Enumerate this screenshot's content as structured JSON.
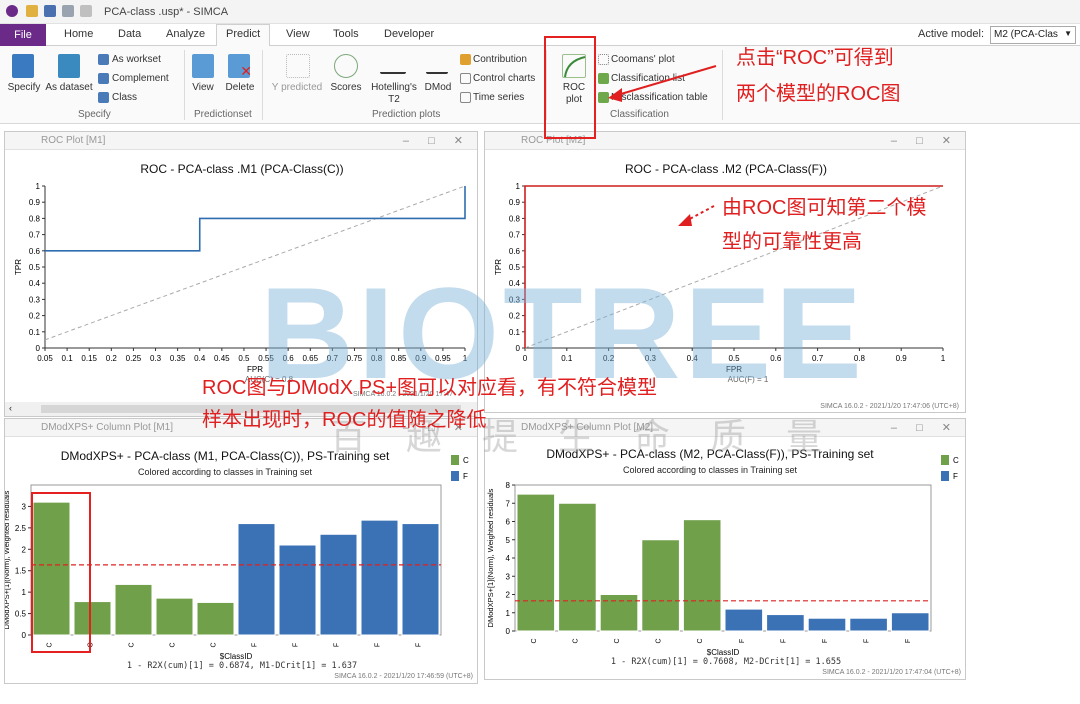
{
  "window": {
    "title": "PCA-class .usp* - SIMCA"
  },
  "tabs": {
    "file": "File",
    "home": "Home",
    "data": "Data",
    "analyze": "Analyze",
    "predict": "Predict",
    "view": "View",
    "tools": "Tools",
    "developer": "Developer"
  },
  "active_model": {
    "label": "Active model:",
    "value": "M2 (PCA-Clas"
  },
  "ribbon": {
    "specify": "Specify",
    "as_dataset": "As dataset",
    "as_workset": "As workset",
    "complement": "Complement",
    "class": "Class",
    "view": "View",
    "delete": "Delete",
    "y_predicted": "Y predicted",
    "scores": "Scores",
    "hotellings": "Hotelling's T2",
    "dmod": "DMod",
    "contribution": "Contribution",
    "control_charts": "Control charts",
    "time_series": "Time series",
    "roc_plot": "ROC plot",
    "coomans": "Coomans' plot",
    "classification_list": "Classification list",
    "misclassification": "Misclassification table",
    "group_specify": "Specify",
    "group_predictionset": "Predictionset",
    "group_prediction_plots": "Prediction plots",
    "group_classification": "Classification"
  },
  "pane_tl": {
    "header": "ROC Plot [M1]",
    "title": "ROC - PCA-class .M1 (PCA-Class(C))",
    "footer": "SIMCA 16.0.2 - 2021/1/20 17:47",
    "auc": "AUC(C) = 0.8"
  },
  "pane_tr": {
    "header": "ROC Plot [M2]",
    "title": "ROC - PCA-class .M2 (PCA-Class(F))",
    "footer": "SIMCA 16.0.2 - 2021/1/20 17:47:06 (UTC+8)",
    "auc": "AUC(F) = 1"
  },
  "pane_bl": {
    "header": "DModXPS+ Column Plot [M1]",
    "title": "DModXPS+ - PCA-class  (M1, PCA-Class(C)), PS-Training set",
    "subtitle": "Colored according to classes in Training set",
    "stat": "1 - R2X(cum)[1] = 0.6874, M1-DCrit[1] = 1.637",
    "footer": "SIMCA 16.0.2 - 2021/1/20 17:46:59 (UTC+8)"
  },
  "pane_br": {
    "header": "DModXPS+ Column Plot [M2]",
    "title": "DModXPS+ - PCA-class  (M2, PCA-Class(F)), PS-Training set",
    "subtitle": "Colored according to classes in Training set",
    "stat": "1 - R2X(cum)[1] = 0.7608, M2-DCrit[1] = 1.655",
    "footer": "SIMCA 16.0.2 - 2021/1/20 17:47:04 (UTC+8)"
  },
  "annotations": {
    "roc_click_1": "点击“ROC”可得到",
    "roc_click_2": "两个模型的ROC图",
    "roc_compare_1": "由ROC图可知第二个模",
    "roc_compare_2": "型的可靠性更高",
    "dmod_1": "ROC图与DModX PS+图可以对应看，有不符合模型",
    "dmod_2": "样本出现时，ROC的值随之降低"
  },
  "watermark": {
    "main": "BIOTREE",
    "sub": "百趣提生命质量"
  },
  "colors": {
    "class_c": "#70a04a",
    "class_f": "#3a72b5",
    "roc_line_m1": "#2e6db0",
    "roc_line_m2": "#cc1f1f",
    "annotation": "#e02020"
  },
  "chart_data": [
    {
      "type": "line",
      "title": "ROC - PCA-class .M1 (PCA-Class(C))",
      "xlabel": "FPR",
      "ylabel": "TPR",
      "xlim": [
        0.05,
        1
      ],
      "ylim": [
        0,
        1
      ],
      "xticks": [
        0.05,
        0.1,
        0.15,
        0.2,
        0.25,
        0.3,
        0.35,
        0.4,
        0.45,
        0.5,
        0.55,
        0.6,
        0.65,
        0.7,
        0.75,
        0.8,
        0.85,
        0.9,
        0.95,
        1
      ],
      "yticks": [
        0,
        0.1,
        0.2,
        0.3,
        0.4,
        0.5,
        0.6,
        0.7,
        0.8,
        0.9,
        1
      ],
      "series": [
        {
          "name": "ROC",
          "x": [
            0,
            0.4,
            0.4,
            1,
            1
          ],
          "y": [
            0.6,
            0.6,
            0.8,
            0.8,
            1
          ]
        }
      ],
      "diagonal": true
    },
    {
      "type": "line",
      "title": "ROC - PCA-class .M2 (PCA-Class(F))",
      "xlabel": "FPR",
      "ylabel": "TPR",
      "xlim": [
        0,
        1
      ],
      "ylim": [
        0,
        1
      ],
      "xticks": [
        0,
        0.1,
        0.2,
        0.3,
        0.4,
        0.5,
        0.6,
        0.7,
        0.8,
        0.9,
        1
      ],
      "yticks": [
        0,
        0.1,
        0.2,
        0.3,
        0.4,
        0.5,
        0.6,
        0.7,
        0.8,
        0.9,
        1
      ],
      "series": [
        {
          "name": "ROC",
          "x": [
            0,
            0,
            1
          ],
          "y": [
            0,
            1,
            1
          ]
        }
      ],
      "diagonal": true
    },
    {
      "type": "bar",
      "title": "DModXPS+ - PCA-class  (M1, PCA-Class(C)), PS-Training set",
      "xlabel": "$ClassID",
      "ylabel": "DModXPS+[1](Norm), Weighted residuals",
      "categories": [
        "C",
        "C",
        "C",
        "C",
        "C",
        "F",
        "F",
        "F",
        "F",
        "F"
      ],
      "values": [
        3.1,
        0.78,
        1.18,
        0.86,
        0.76,
        2.6,
        2.1,
        2.35,
        2.68,
        2.6
      ],
      "ylim": [
        0,
        3.5
      ],
      "yticks": [
        0,
        0.5,
        1,
        1.5,
        2,
        2.5,
        3
      ],
      "dcrit": 1.637,
      "legend": [
        "C",
        "F"
      ]
    },
    {
      "type": "bar",
      "title": "DModXPS+ - PCA-class  (M2, PCA-Class(F)), PS-Training set",
      "xlabel": "$ClassID",
      "ylabel": "DModXPS+[1](Norm), Weighted residuals",
      "categories": [
        "C",
        "C",
        "C",
        "C",
        "C",
        "F",
        "F",
        "F",
        "F",
        "F"
      ],
      "values": [
        7.5,
        7.0,
        2.0,
        5.0,
        6.1,
        1.2,
        0.9,
        0.7,
        0.7,
        1.0
      ],
      "ylim": [
        0,
        8
      ],
      "yticks": [
        0,
        1,
        2,
        3,
        4,
        5,
        6,
        7,
        8
      ],
      "dcrit": 1.655,
      "legend": [
        "C",
        "F"
      ]
    }
  ]
}
